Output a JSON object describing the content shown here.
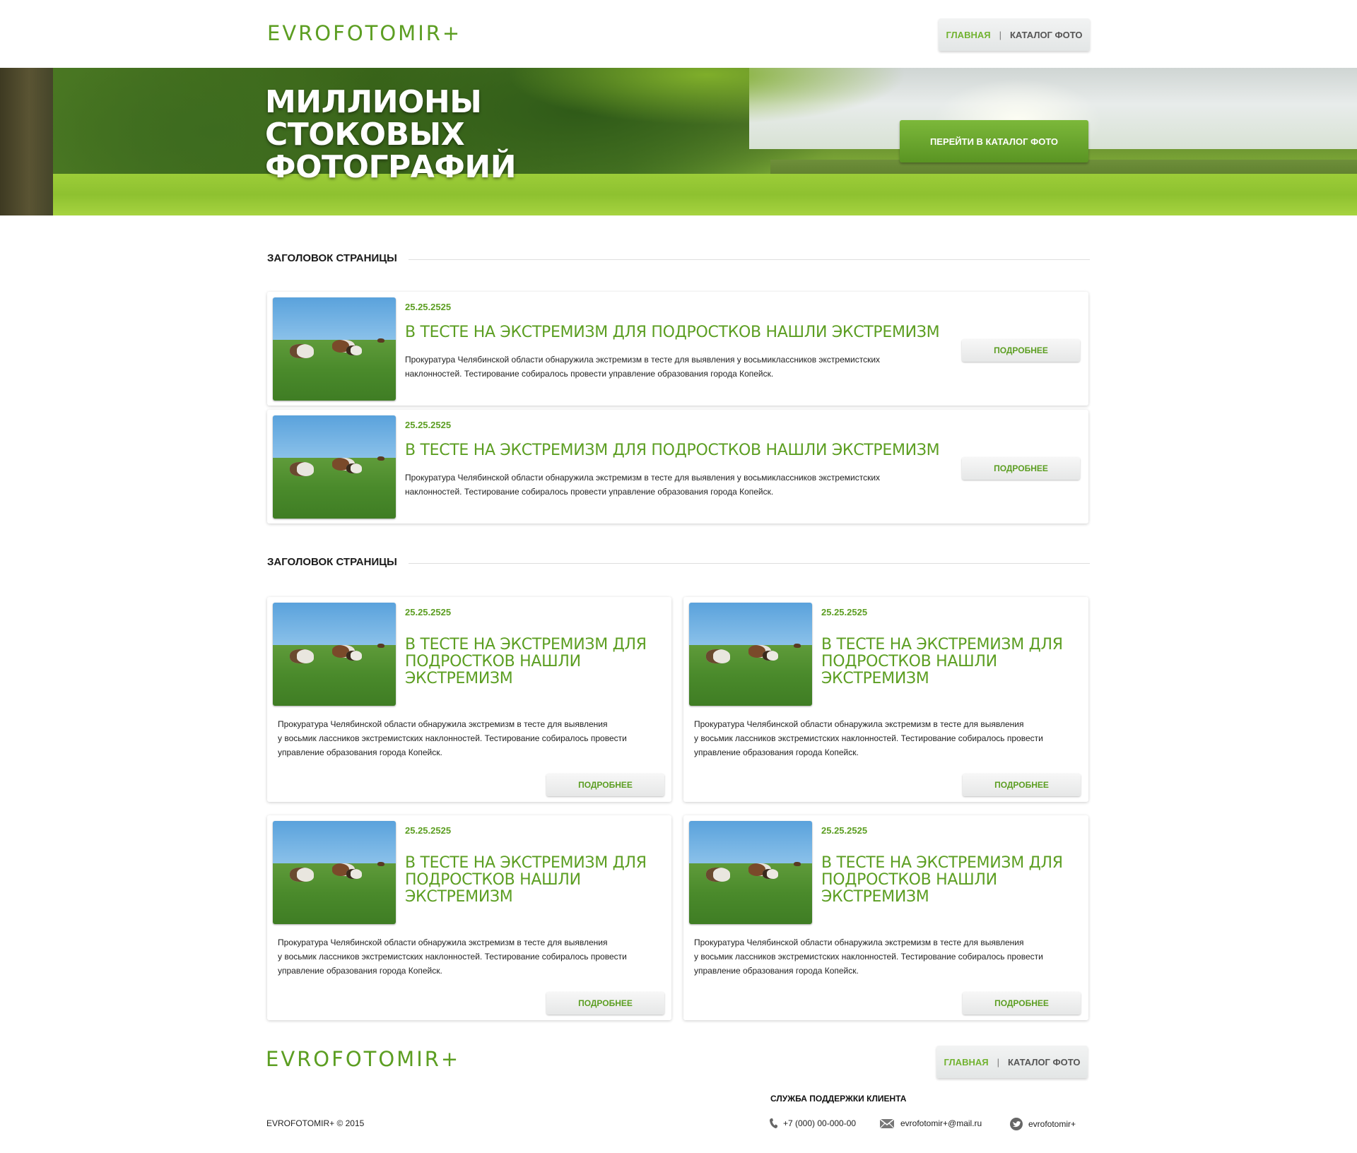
{
  "header": {
    "logo": "EVROFOTOMIR+",
    "nav": {
      "home": "ГЛАВНАЯ",
      "separator": "|",
      "catalog": "КАТАЛОГ ФОТО"
    }
  },
  "hero": {
    "title_lines": [
      "МИЛЛИОНЫ",
      "СТОКОВЫХ",
      "ФОТОГРАФИЙ"
    ],
    "button": "ПЕРЕЙТИ В КАТАЛОГ ФОТО"
  },
  "sections": [
    {
      "title": "ЗАГОЛОВОК СТРАНИЦЫ",
      "items": [
        {
          "date": "25.25.2525",
          "title": "В ТЕСТЕ НА ЭКСТРЕМИЗМ ДЛЯ ПОДРОСТКОВ НАШЛИ ЭКСТРЕМИЗМ",
          "text_lines": [
            "Прокуратура Челябинской области обнаружила экстремизм в тесте для выявления у восьмиклассников экстремистских",
            "наклонностей. Тестирование собиралось провести управление образования города Копейск."
          ],
          "button": "ПОДРОБНЕЕ"
        },
        {
          "date": "25.25.2525",
          "title": "В ТЕСТЕ НА ЭКСТРЕМИЗМ ДЛЯ ПОДРОСТКОВ НАШЛИ ЭКСТРЕМИЗМ",
          "text_lines": [
            "Прокуратура Челябинской области обнаружила экстремизм в тесте для выявления у восьмиклассников экстремистских",
            "наклонностей. Тестирование собиралось провести управление образования города Копейск."
          ],
          "button": "ПОДРОБНЕЕ"
        }
      ]
    },
    {
      "title": "ЗАГОЛОВОК СТРАНИЦЫ",
      "items": [
        {
          "date": "25.25.2525",
          "title_lines": [
            "В ТЕСТЕ НА ЭКСТРЕМИЗМ ДЛЯ",
            "ПОДРОСТКОВ НАШЛИ",
            "ЭКСТРЕМИЗМ"
          ],
          "text_lines": [
            "Прокуратура Челябинской области обнаружила экстремизм в тесте для выявления",
            "у восьмик лассников экстремистских наклонностей. Тестирование собиралось провести",
            "управление образования города Копейск."
          ],
          "button": "ПОДРОБНЕЕ"
        },
        {
          "date": "25.25.2525",
          "title_lines": [
            "В ТЕСТЕ НА ЭКСТРЕМИЗМ ДЛЯ",
            "ПОДРОСТКОВ НАШЛИ",
            "ЭКСТРЕМИЗМ"
          ],
          "text_lines": [
            "Прокуратура Челябинской области обнаружила экстремизм в тесте для выявления",
            "у восьмик лассников экстремистских наклонностей. Тестирование собиралось провести",
            "управление образования города Копейск."
          ],
          "button": "ПОДРОБНЕЕ"
        },
        {
          "date": "25.25.2525",
          "title_lines": [
            "В ТЕСТЕ НА ЭКСТРЕМИЗМ ДЛЯ",
            "ПОДРОСТКОВ НАШЛИ",
            "ЭКСТРЕМИЗМ"
          ],
          "text_lines": [
            "Прокуратура Челябинской области обнаружила экстремизм в тесте для выявления",
            "у восьмик лассников экстремистских наклонностей. Тестирование собиралось провести",
            "управление образования города Копейск."
          ],
          "button": "ПОДРОБНЕЕ"
        },
        {
          "date": "25.25.2525",
          "title_lines": [
            "В ТЕСТЕ НА ЭКСТРЕМИЗМ ДЛЯ",
            "ПОДРОСТКОВ НАШЛИ",
            "ЭКСТРЕМИЗМ"
          ],
          "text_lines": [
            "Прокуратура Челябинской области обнаружила экстремизм в тесте для выявления",
            "у восьмик лассников экстремистских наклонностей. Тестирование собиралось провести",
            "управление образования города Копейск."
          ],
          "button": "ПОДРОБНЕЕ"
        }
      ]
    }
  ],
  "footer": {
    "logo": "EVROFOTOMIR+",
    "nav": {
      "home": "ГЛАВНАЯ",
      "separator": "|",
      "catalog": "КАТАЛОГ ФОТО"
    },
    "copyright": "EVROFOTOMIR+ © 2015",
    "support_title": "СЛУЖБА ПОДДЕРЖКИ КЛИЕНТА",
    "phone": "+7 (000) 00-000-00",
    "email": "evrofotomir+@mail.ru",
    "twitter": "evrofotomir+",
    "icons": {
      "phone": "phone-icon",
      "email": "envelope-icon",
      "twitter": "twitter-icon"
    }
  },
  "colors": {
    "accent": "#5c9e22",
    "nav_active": "#72b331",
    "button_green": "#6aa82e"
  }
}
